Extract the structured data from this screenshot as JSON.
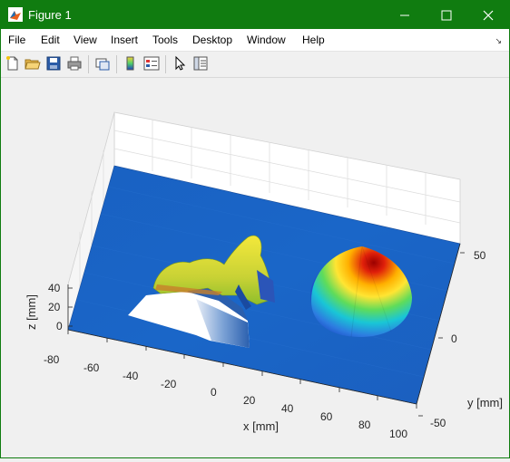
{
  "window": {
    "title": "Figure 1",
    "accent": "#107c10"
  },
  "window_controls": [
    "minimize-icon",
    "maximize-icon",
    "close-icon"
  ],
  "menu": [
    "File",
    "Edit",
    "View",
    "Insert",
    "Tools",
    "Desktop",
    "Window",
    "Help"
  ],
  "toolbar_icons": [
    "new-figure-icon",
    "open-file-icon",
    "save-icon",
    "print-icon",
    "link-plot-icon",
    "insert-colorbar-icon",
    "insert-legend-icon",
    "edit-plot-icon",
    "property-inspector-icon"
  ],
  "chart_data": {
    "type": "surface3d",
    "xlabel": "x [mm]",
    "ylabel": "y [mm]",
    "zlabel": "z [mm]",
    "xticks": [
      "-80",
      "-60",
      "-40",
      "-20",
      "0",
      "20",
      "40",
      "60",
      "80",
      "100"
    ],
    "yticks": [
      "50",
      "0",
      "-50"
    ],
    "zticks": [
      "40",
      "20",
      "0"
    ],
    "colormap": "jet",
    "grid": true
  }
}
